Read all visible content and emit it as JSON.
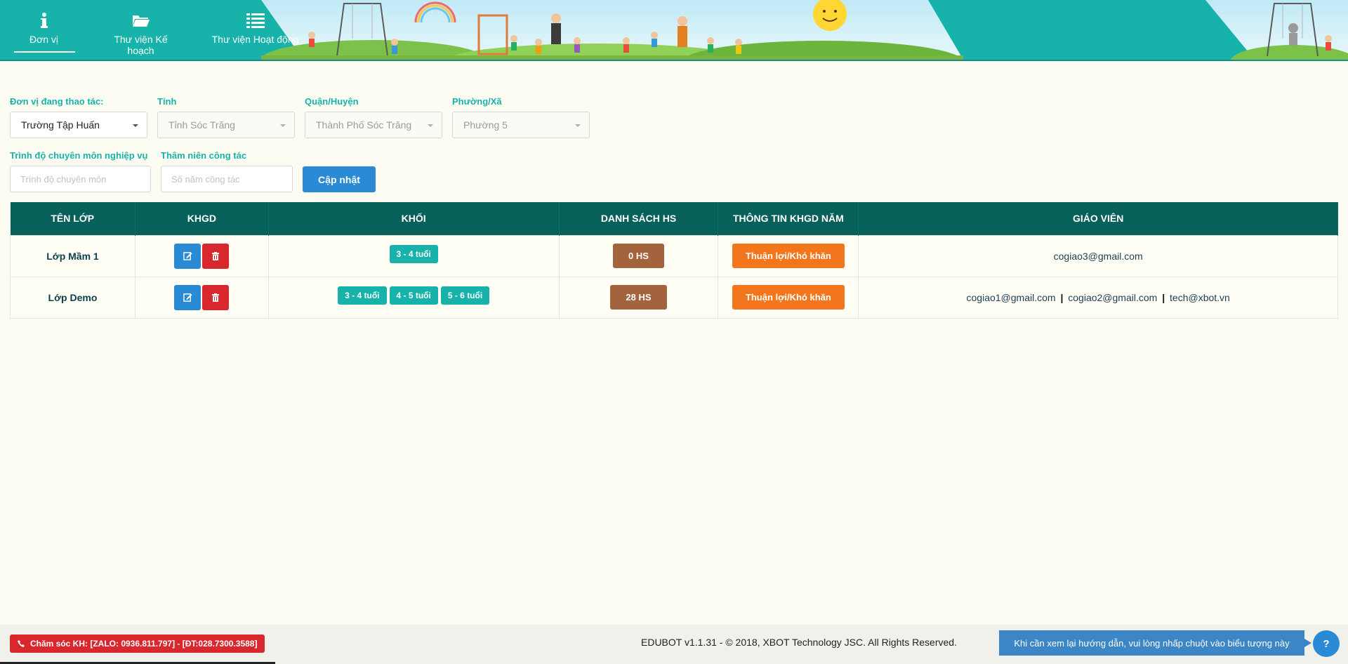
{
  "nav": [
    {
      "label": "Đơn vị",
      "icon": "info-icon",
      "active": true
    },
    {
      "label": "Thư viện Kế hoạch",
      "icon": "folder-open-icon"
    },
    {
      "label": "Thư viện Hoạt động",
      "icon": "list-icon"
    }
  ],
  "form": {
    "unit_label": "Đơn vị đang thao tác:",
    "unit_value": "Trường Tập Huấn",
    "province_label": "Tỉnh",
    "province_value": "Tỉnh Sóc Trăng",
    "district_label": "Quận/Huyện",
    "district_value": "Thành Phố Sóc Trăng",
    "ward_label": "Phường/Xã",
    "ward_value": "Phường 5",
    "level_label": "Trình độ chuyên môn nghiệp vụ",
    "level_placeholder": "Trình độ chuyên môn",
    "seniority_label": "Thâm niên công tác",
    "seniority_placeholder": "Số năm công tác",
    "update_button": "Cập nhật"
  },
  "table": {
    "headers": [
      "TÊN LỚP",
      "KHGD",
      "KHỐI",
      "DANH SÁCH HS",
      "THÔNG TIN KHGD NĂM",
      "GIÁO VIÊN"
    ],
    "rows": [
      {
        "name": "Lớp Mầm 1",
        "grades": [
          "3 - 4 tuổi"
        ],
        "students": "0 HS",
        "info_button": "Thuận lợi/Khó khăn",
        "teachers": [
          "cogiao3@gmail.com"
        ]
      },
      {
        "name": "Lớp Demo",
        "grades": [
          "3 - 4 tuổi",
          "4 - 5 tuổi",
          "5 - 6 tuổi"
        ],
        "students": "28 HS",
        "info_button": "Thuận lợi/Khó khăn",
        "teachers": [
          "cogiao1@gmail.com",
          "cogiao2@gmail.com",
          "tech@xbot.vn"
        ]
      }
    ],
    "teacher_separator": "|"
  },
  "footer": {
    "support": "Chăm sóc KH: [ZALO: 0936.811.797] - [ĐT:028.7300.3588]",
    "copyright": "EDUBOT v1.1.31 - © 2018, XBOT Technology JSC. All Rights Reserved.",
    "help_tip": "Khi cần xem lại hướng dẫn, vui lòng nhấp chuột vào biểu tượng này",
    "help_button": "?"
  },
  "colors": {
    "header": "#17b3ab",
    "table_header": "#07605a",
    "primary_button": "#2a8bd4",
    "danger": "#d9272e",
    "orange": "#f4761c",
    "brown": "#a2633d",
    "background": "#fdfcf3"
  }
}
